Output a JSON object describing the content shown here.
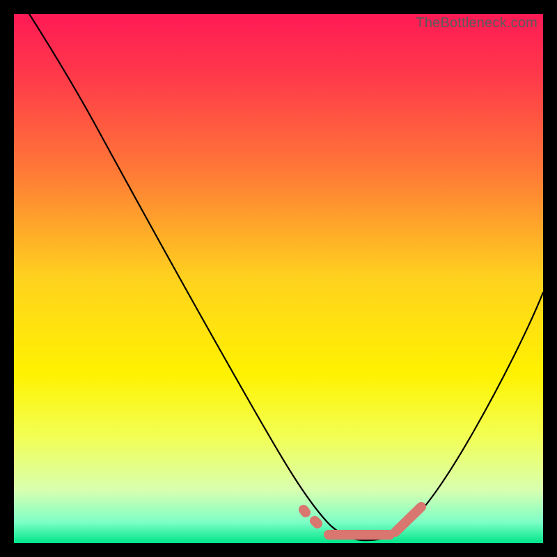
{
  "watermark": {
    "text": "TheBottleneck.com"
  },
  "chart_data": {
    "type": "line",
    "title": "",
    "xlabel": "",
    "ylabel": "",
    "xlim": [
      0,
      100
    ],
    "ylim": [
      0,
      100
    ],
    "series": [
      {
        "name": "bottleneck-curve",
        "color": "#000000",
        "x": [
          3,
          10,
          20,
          30,
          40,
          50,
          55,
          58,
          60,
          62,
          65,
          70,
          75,
          80,
          85,
          90,
          95,
          99
        ],
        "y": [
          100,
          88,
          70,
          52,
          34,
          16,
          8,
          3,
          1,
          0,
          0,
          0,
          2,
          8,
          18,
          30,
          42,
          52
        ]
      },
      {
        "name": "optimal-segment",
        "color": "#d8766f",
        "style": "dotted-thick",
        "x": [
          55,
          58,
          61,
          64,
          67,
          70,
          72,
          74,
          76
        ],
        "y": [
          6,
          3,
          1,
          0,
          0,
          0,
          2,
          5,
          9
        ]
      }
    ],
    "background_gradient": {
      "stops": [
        {
          "offset": 0.0,
          "color": "#ff1a55"
        },
        {
          "offset": 0.12,
          "color": "#ff3a4a"
        },
        {
          "offset": 0.3,
          "color": "#ff7a36"
        },
        {
          "offset": 0.5,
          "color": "#ffd21e"
        },
        {
          "offset": 0.68,
          "color": "#fff200"
        },
        {
          "offset": 0.8,
          "color": "#f2ff55"
        },
        {
          "offset": 0.9,
          "color": "#d8ffb0"
        },
        {
          "offset": 0.96,
          "color": "#7fffc7"
        },
        {
          "offset": 1.0,
          "color": "#00e58a"
        }
      ]
    }
  }
}
